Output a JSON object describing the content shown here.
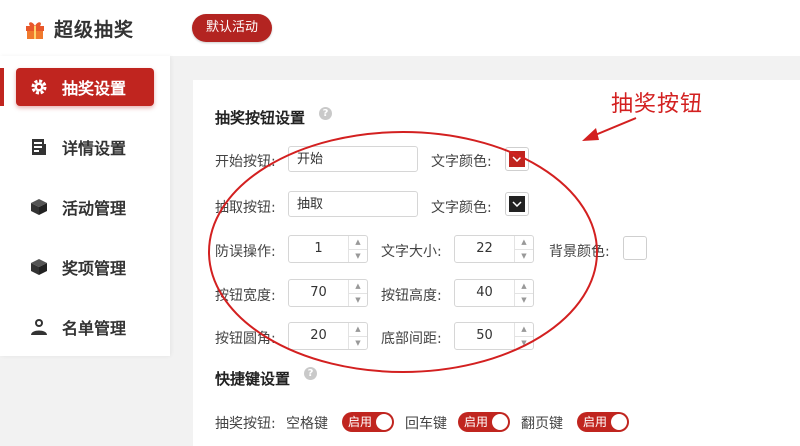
{
  "app": {
    "title": "超级抽奖",
    "activity_button": "默认活动"
  },
  "sidebar": {
    "items": [
      {
        "label": "抽奖设置",
        "icon": "gear-icon",
        "active": true
      },
      {
        "label": "详情设置",
        "icon": "document-icon",
        "active": false
      },
      {
        "label": "活动管理",
        "icon": "box-icon",
        "active": false
      },
      {
        "label": "奖项管理",
        "icon": "box-icon",
        "active": false
      },
      {
        "label": "名单管理",
        "icon": "user-icon",
        "active": false
      }
    ]
  },
  "button_settings": {
    "title": "抽奖按钮设置",
    "start_label": "开始按钮:",
    "start_value": "开始",
    "start_color_label": "文字颜色:",
    "draw_label": "抽取按钮:",
    "draw_value": "抽取",
    "draw_color_label": "文字颜色:",
    "misclick_label": "防误操作:",
    "misclick_value": "1",
    "font_size_label": "文字大小:",
    "font_size_value": "22",
    "bg_color_label": "背景颜色:",
    "width_label": "按钮宽度:",
    "width_value": "70",
    "height_label": "按钮高度:",
    "height_value": "40",
    "radius_label": "按钮圆角:",
    "radius_value": "20",
    "bottom_label": "底部间距:",
    "bottom_value": "50"
  },
  "shortcut_settings": {
    "title": "快捷键设置",
    "row_label": "抽奖按钮:",
    "keys": [
      {
        "label": "空格键",
        "toggle": "启用"
      },
      {
        "label": "回车键",
        "toggle": "启用"
      },
      {
        "label": "翻页键",
        "toggle": "启用"
      }
    ]
  },
  "annotation": {
    "text": "抽奖按钮"
  },
  "colors": {
    "accent": "#c0251f",
    "start_text_color": "#c0251f",
    "draw_text_color": "#222222",
    "background_color": "#ffffff",
    "annotation": "#d32020"
  }
}
